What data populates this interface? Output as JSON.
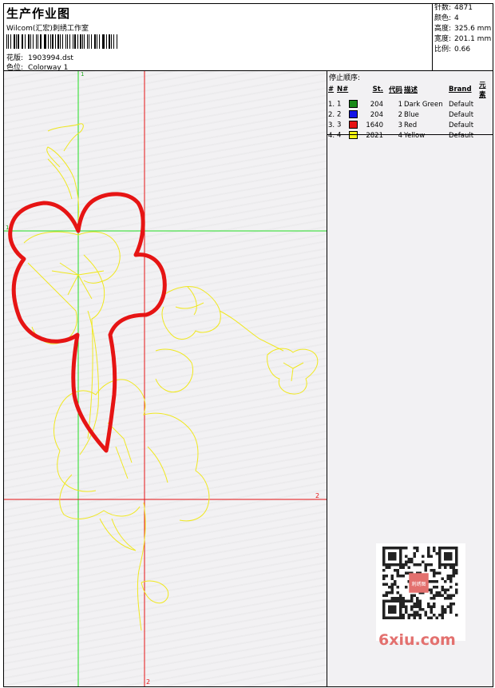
{
  "header": {
    "title": "生产作业图",
    "brand_line": "Wilcom(汇宏)刺绣工作室",
    "design_label": "花版:",
    "design_value": "1903994.dst",
    "color_label": "色位:",
    "color_value": "Colorway 1"
  },
  "stats": [
    {
      "label": "针数:",
      "value": "4871"
    },
    {
      "label": "颜色:",
      "value": "4"
    },
    {
      "label": "高度:",
      "value": "325.6 mm"
    },
    {
      "label": "宽度:",
      "value": "201.1 mm"
    },
    {
      "label": "比例:",
      "value": "0.66"
    }
  ],
  "stop_sequence": {
    "title": "停止顺序:",
    "columns": [
      "#",
      "N#",
      "St.",
      "代码",
      "描述",
      "Brand",
      "元素"
    ],
    "rows": [
      {
        "idx": "1.",
        "n": "1",
        "color": "#1a8a1a",
        "st": "204",
        "code": "1",
        "desc": "Dark Green",
        "brand": "Default"
      },
      {
        "idx": "2.",
        "n": "2",
        "color": "#1414e6",
        "st": "204",
        "code": "2",
        "desc": "Blue",
        "brand": "Default"
      },
      {
        "idx": "3.",
        "n": "3",
        "color": "#e61414",
        "st": "1640",
        "code": "3",
        "desc": "Red",
        "brand": "Default"
      },
      {
        "idx": "4.",
        "n": "4",
        "color": "#f5f514",
        "st": "2821",
        "code": "4",
        "desc": "Yellow",
        "brand": "Default"
      }
    ]
  },
  "guides": {
    "green_top": "1",
    "green_left": "1",
    "red_right": "2",
    "red_bottom": "2"
  },
  "colors": {
    "green_guide": "#22dd22",
    "red_guide": "#e61414",
    "outline": "#f0e820",
    "satin": "#e61414",
    "watermark": "#e3706e"
  },
  "watermark": {
    "text": "6xiu.com",
    "seal_text": "刺绣图"
  }
}
